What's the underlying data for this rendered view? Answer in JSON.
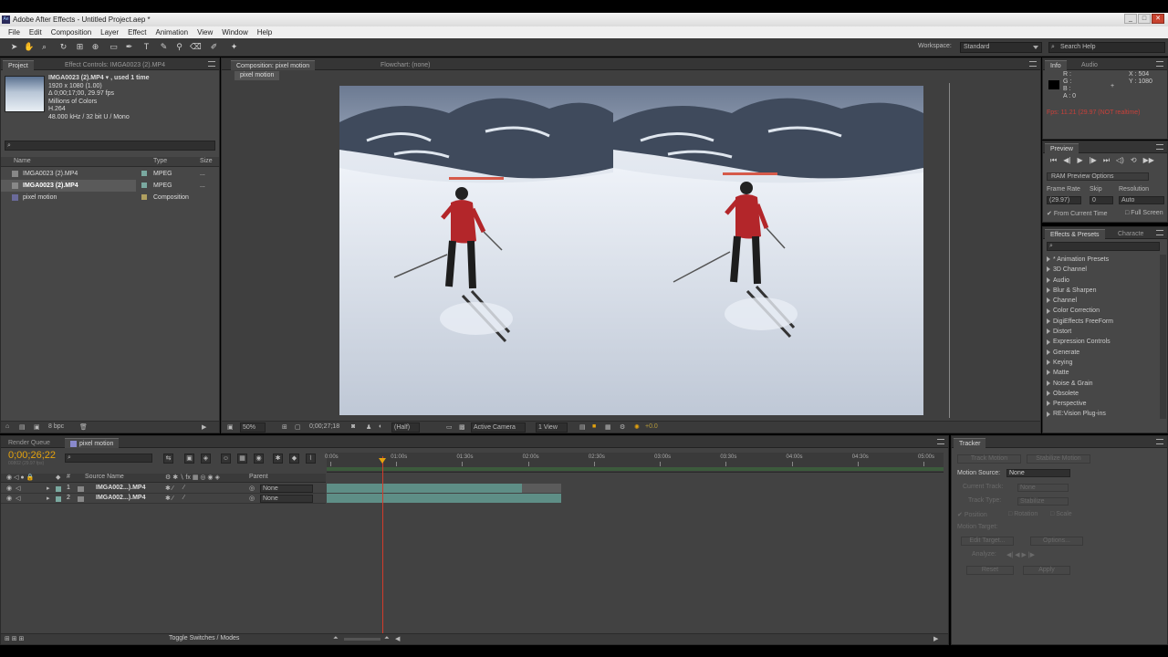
{
  "window": {
    "title": "Adobe After Effects - Untitled Project.aep *",
    "minimize": "_",
    "maximize": "□",
    "close": "✕"
  },
  "menu": [
    "File",
    "Edit",
    "Composition",
    "Layer",
    "Effect",
    "Animation",
    "View",
    "Window",
    "Help"
  ],
  "toolbar": {
    "workspace_label": "Workspace:",
    "workspace_value": "Standard",
    "search_placeholder": "Search Help"
  },
  "project": {
    "tab_project": "Project",
    "tab_effect_controls": "Effect Controls: IMGA0023 (2).MP4",
    "item_name": "IMGA0023 (2).MP4 ▾ , used 1 time",
    "item_size": "1920 x 1080 (1.00)",
    "item_duration": "Δ 0;00;17;00, 29.97 fps",
    "item_colors": "Millions of Colors",
    "item_codec": "H.264",
    "item_audio": "48.000 kHz / 32 bit U / Mono",
    "search_placeholder": "",
    "col_name": "Name",
    "col_type": "Type",
    "col_size": "Size",
    "items": [
      {
        "name": "IMGA0023 (2).MP4",
        "type": "MPEG",
        "size": "..."
      },
      {
        "name": "IMGA0023 (2).MP4",
        "type": "MPEG",
        "size": "..."
      },
      {
        "name": "pixel motion",
        "type": "Composition",
        "size": ""
      }
    ],
    "bpc": "8 bpc"
  },
  "composition": {
    "tab_comp": "Composition: pixel motion",
    "tab_flowchart": "Flowchart: (none)",
    "breadcrumb": "pixel motion",
    "zoom": "50%",
    "timecode": "0;00;27;18",
    "resolution": "(Half)",
    "camera": "Active Camera",
    "view": "1 View",
    "exposure": "+0.0"
  },
  "info": {
    "tab_info": "Info",
    "tab_audio": "Audio",
    "r": "R :",
    "g": "G :",
    "b": "B :",
    "a": "A : 0",
    "x": "X : 504",
    "y": "Y : 1080",
    "warning": "Fps: 11.21 (29.97 (NOT realtime)"
  },
  "preview": {
    "tab": "Preview",
    "ram_options": "RAM Preview Options",
    "frame_rate_label": "Frame Rate",
    "skip_label": "Skip",
    "resolution_label": "Resolution",
    "frame_rate_value": "(29.97)",
    "skip_value": "0",
    "resolution_value": "Auto",
    "from_current": "From Current Time",
    "full_screen": "Full Screen"
  },
  "effects": {
    "tab_effects": "Effects & Presets",
    "tab_character": "Characte",
    "search_placeholder": "",
    "items": [
      "* Animation Presets",
      "3D Channel",
      "Audio",
      "Blur & Sharpen",
      "Channel",
      "Color Correction",
      "DigiEffects FreeForm",
      "Distort",
      "Expression Controls",
      "Generate",
      "Keying",
      "Matte",
      "Noise & Grain",
      "Obsolete",
      "Perspective",
      "RE:Vision Plug-ins"
    ]
  },
  "timeline": {
    "tab_render": "Render Queue",
    "tab_comp": "pixel motion",
    "timecode": "0;00;26;22",
    "timecode_sub": "00802 (29.97 fps)",
    "search_placeholder": "",
    "col_source": "Source Name",
    "col_parent": "Parent",
    "ruler": [
      "0:00s",
      "01:00s",
      "01:30s",
      "02:00s",
      "02:30s",
      "03:00s",
      "03:30s",
      "04:00s",
      "04:30s",
      "05:00s"
    ],
    "layers": [
      {
        "num": "1",
        "name": "IMGA002...).MP4",
        "parent": "None"
      },
      {
        "num": "2",
        "name": "IMGA002...).MP4",
        "parent": "None"
      }
    ],
    "toggle": "Toggle Switches / Modes",
    "playhead": 0.09
  },
  "tracker": {
    "tab": "Tracker",
    "track_motion": "Track Motion",
    "stabilize_motion": "Stabilize Motion",
    "motion_source_label": "Motion Source:",
    "motion_source_value": "None",
    "current_track_label": "Current Track:",
    "current_track_value": "None",
    "track_type_label": "Track Type:",
    "track_type_value": "Stabilize",
    "position": "Position",
    "rotation": "Rotation",
    "scale": "Scale",
    "motion_target": "Motion Target:",
    "edit_target": "Edit Target...",
    "options": "Options...",
    "analyze": "Analyze:",
    "reset": "Reset",
    "apply": "Apply"
  },
  "colors": {
    "accent_orange": "#e5a30e",
    "playhead_red": "#d33b2a",
    "layer_bar": "#5e8e86"
  }
}
